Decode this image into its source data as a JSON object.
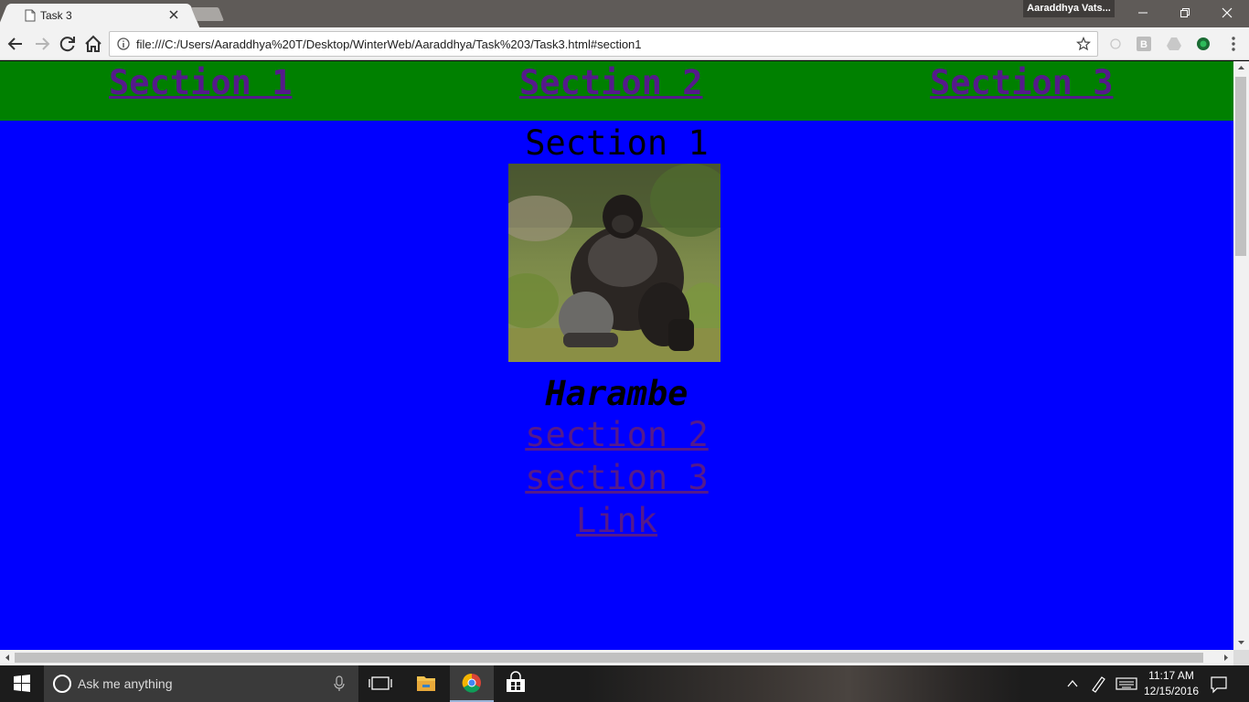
{
  "browser": {
    "tab_title": "Task 3",
    "profile_name": "Aaraddhya Vats...",
    "url": "file:///C:/Users/Aaraddhya%20T/Desktop/WinterWeb/Aaraddhya/Task%203/Task3.html#section1",
    "extension_labels": [
      "B"
    ]
  },
  "page": {
    "nav": [
      "Section 1",
      "Section 2",
      "Section 3"
    ],
    "section_title": "Section 1",
    "image_caption": "Harambe",
    "links": [
      "section 2 ",
      "section 3 ",
      "Link "
    ],
    "colors": {
      "nav_bg": "#008000",
      "body_bg": "#0000ff",
      "link": "#551a8b"
    }
  },
  "taskbar": {
    "search_placeholder": "Ask me anything",
    "time": "11:17 AM",
    "date": "12/15/2016",
    "apps": [
      "task-view-icon",
      "file-explorer-icon",
      "chrome-icon",
      "store-icon"
    ]
  }
}
